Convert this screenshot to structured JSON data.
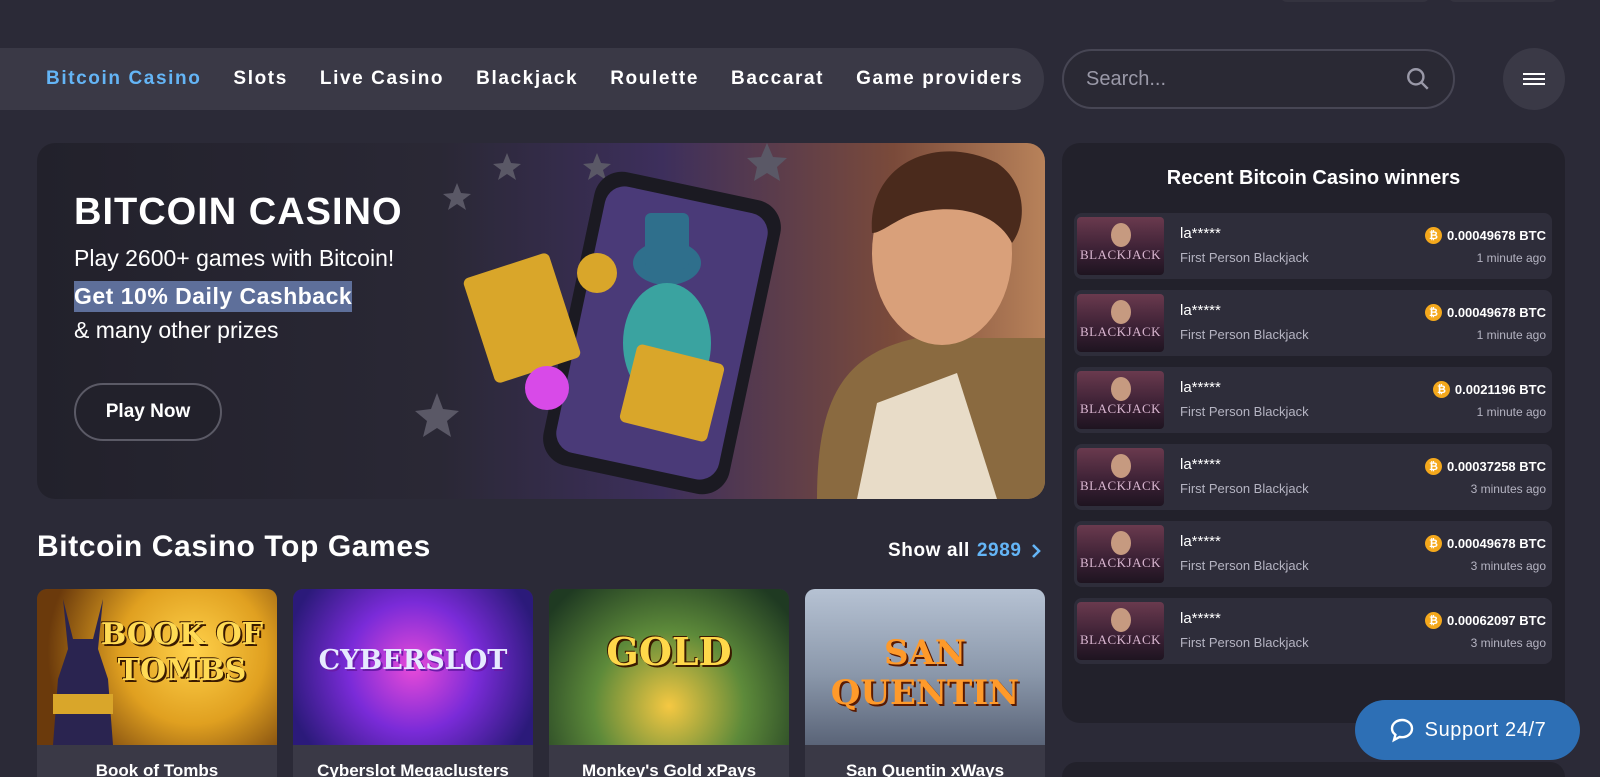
{
  "nav": {
    "items": [
      {
        "label": "Bitcoin Casino",
        "active": true
      },
      {
        "label": "Slots",
        "active": false
      },
      {
        "label": "Live Casino",
        "active": false
      },
      {
        "label": "Blackjack",
        "active": false
      },
      {
        "label": "Roulette",
        "active": false
      },
      {
        "label": "Baccarat",
        "active": false
      },
      {
        "label": "Game providers",
        "active": false
      }
    ]
  },
  "search": {
    "placeholder": "Search..."
  },
  "hero": {
    "title": "BITCOIN CASINO",
    "line1": "Play 2600+ games with Bitcoin!",
    "line2": "Get 10% Daily Cashback",
    "line3": "& many other prizes",
    "button": "Play Now"
  },
  "top_games": {
    "title": "Bitcoin Casino Top Games",
    "show_all_label": "Show all",
    "show_all_count": "2989",
    "games": [
      {
        "name": "Book of Tombs",
        "thumb_text": "BOOK OF TOMBS"
      },
      {
        "name": "Cyberslot Megaclusters",
        "thumb_text": "CYBERSLOT"
      },
      {
        "name": "Monkey's Gold xPays",
        "thumb_text": "GOLD"
      },
      {
        "name": "San Quentin xWays",
        "thumb_text": "SAN QUENTIN"
      }
    ]
  },
  "winners": {
    "title": "Recent Bitcoin Casino winners",
    "thumb_label": "BLACKJACK",
    "rows": [
      {
        "user": "la*****",
        "game": "First Person Blackjack",
        "amount": "0.00049678 BTC",
        "time": "1 minute ago"
      },
      {
        "user": "la*****",
        "game": "First Person Blackjack",
        "amount": "0.00049678 BTC",
        "time": "1 minute ago"
      },
      {
        "user": "la*****",
        "game": "First Person Blackjack",
        "amount": "0.0021196 BTC",
        "time": "1 minute ago"
      },
      {
        "user": "la*****",
        "game": "First Person Blackjack",
        "amount": "0.00037258 BTC",
        "time": "3 minutes ago"
      },
      {
        "user": "la*****",
        "game": "First Person Blackjack",
        "amount": "0.00049678 BTC",
        "time": "3 minutes ago"
      },
      {
        "user": "la*****",
        "game": "First Person Blackjack",
        "amount": "0.00062097 BTC",
        "time": "3 minutes ago"
      }
    ]
  },
  "support": {
    "label": "Support 24/7"
  },
  "colors": {
    "accent": "#64b5f6",
    "background": "#2b2a37",
    "support": "#2d6fb5",
    "coin": "#f4a81c"
  }
}
